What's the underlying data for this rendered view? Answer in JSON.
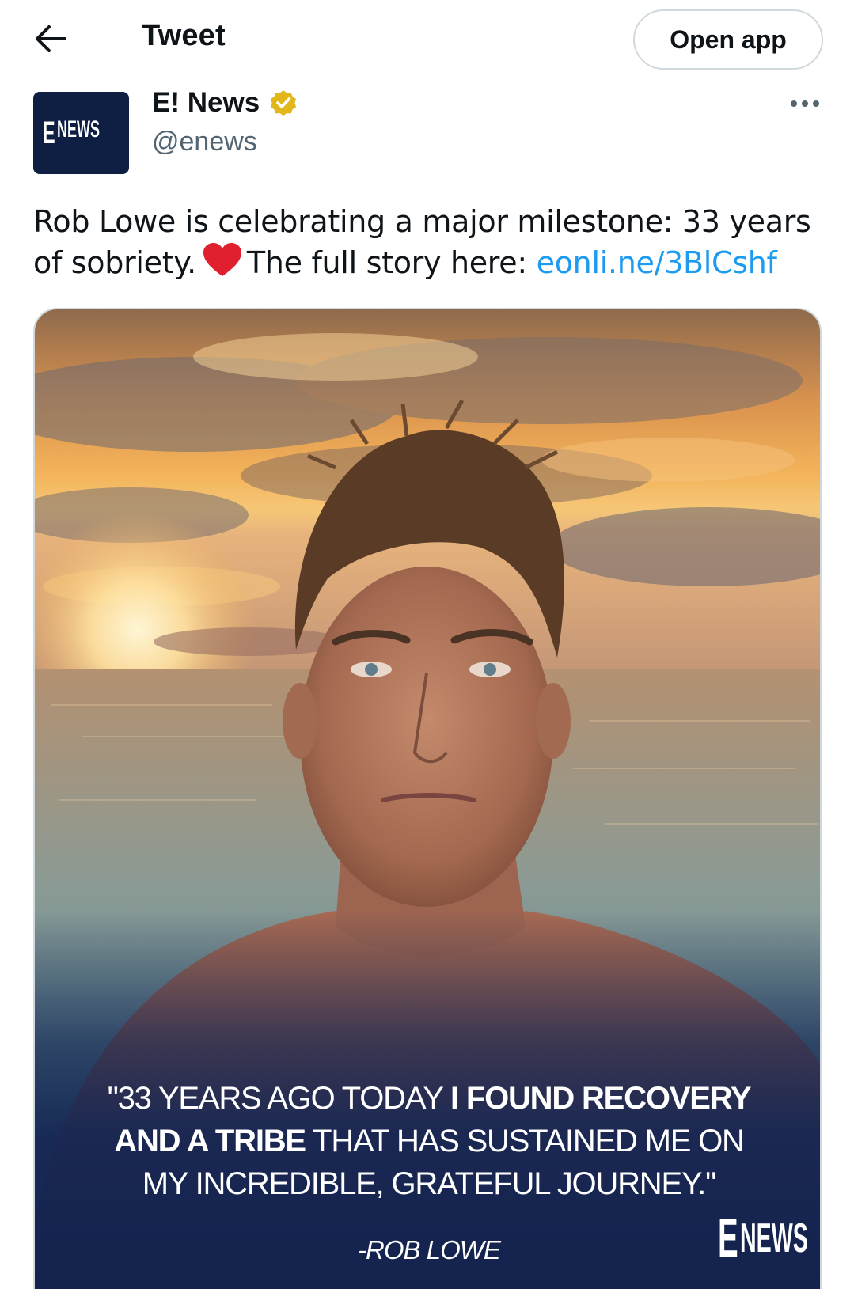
{
  "header": {
    "title": "Tweet",
    "open_app_label": "Open app",
    "back_icon": "arrow-left-icon"
  },
  "author": {
    "name": "E! News",
    "handle": "@enews",
    "verified": true,
    "verified_color": "#e2b719",
    "avatar_logo": {
      "e": "E",
      "news": "NEWS"
    }
  },
  "tweet": {
    "text_before_heart": "Rob Lowe is celebrating a major milestone: 33 years of sobriety.",
    "text_after_heart": "The full story here:",
    "link": "eonli.ne/3BlCshf",
    "emoji": "red-heart-emoji"
  },
  "media": {
    "quote_line1_normal": "\"33 YEARS AGO TODAY ",
    "quote_line1_bold": "I FOUND RECOVERY",
    "quote_line2_bold": "AND A TRIBE",
    "quote_line2_normal": " THAT HAS SUSTAINED ME ON",
    "quote_line3": "MY INCREDIBLE, GRATEFUL JOURNEY.\"",
    "attribution": "-ROB LOWE",
    "logo": {
      "e": "E",
      "news": "NEWS"
    }
  },
  "colors": {
    "link": "#1d9bf0",
    "avatar_bg": "#0f1f44",
    "quote_overlay": "#142552"
  }
}
